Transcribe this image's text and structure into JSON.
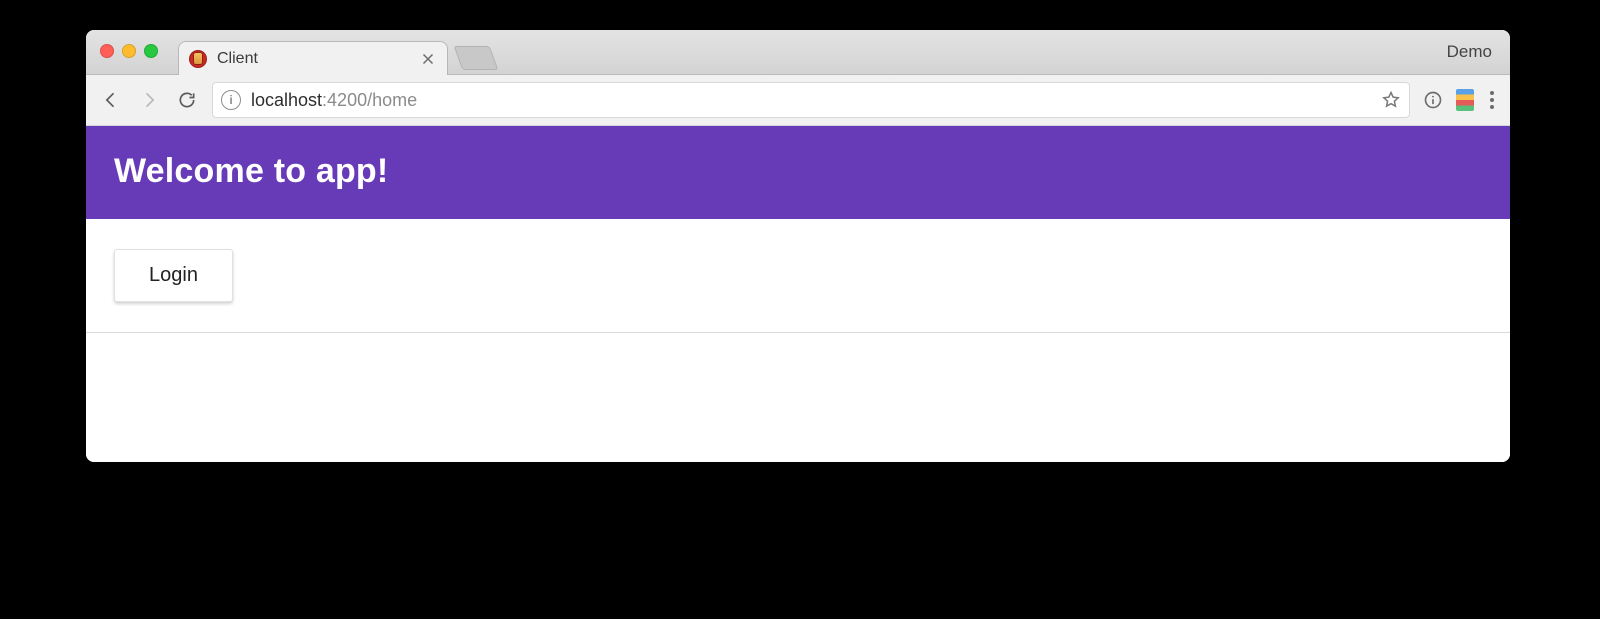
{
  "browser": {
    "tab_title": "Client",
    "user_label": "Demo",
    "url_host": "localhost",
    "url_portpath": ":4200/home",
    "site_info_glyph": "i"
  },
  "app": {
    "header_title": "Welcome to app!",
    "login_label": "Login",
    "accent_color": "#673ab7"
  }
}
